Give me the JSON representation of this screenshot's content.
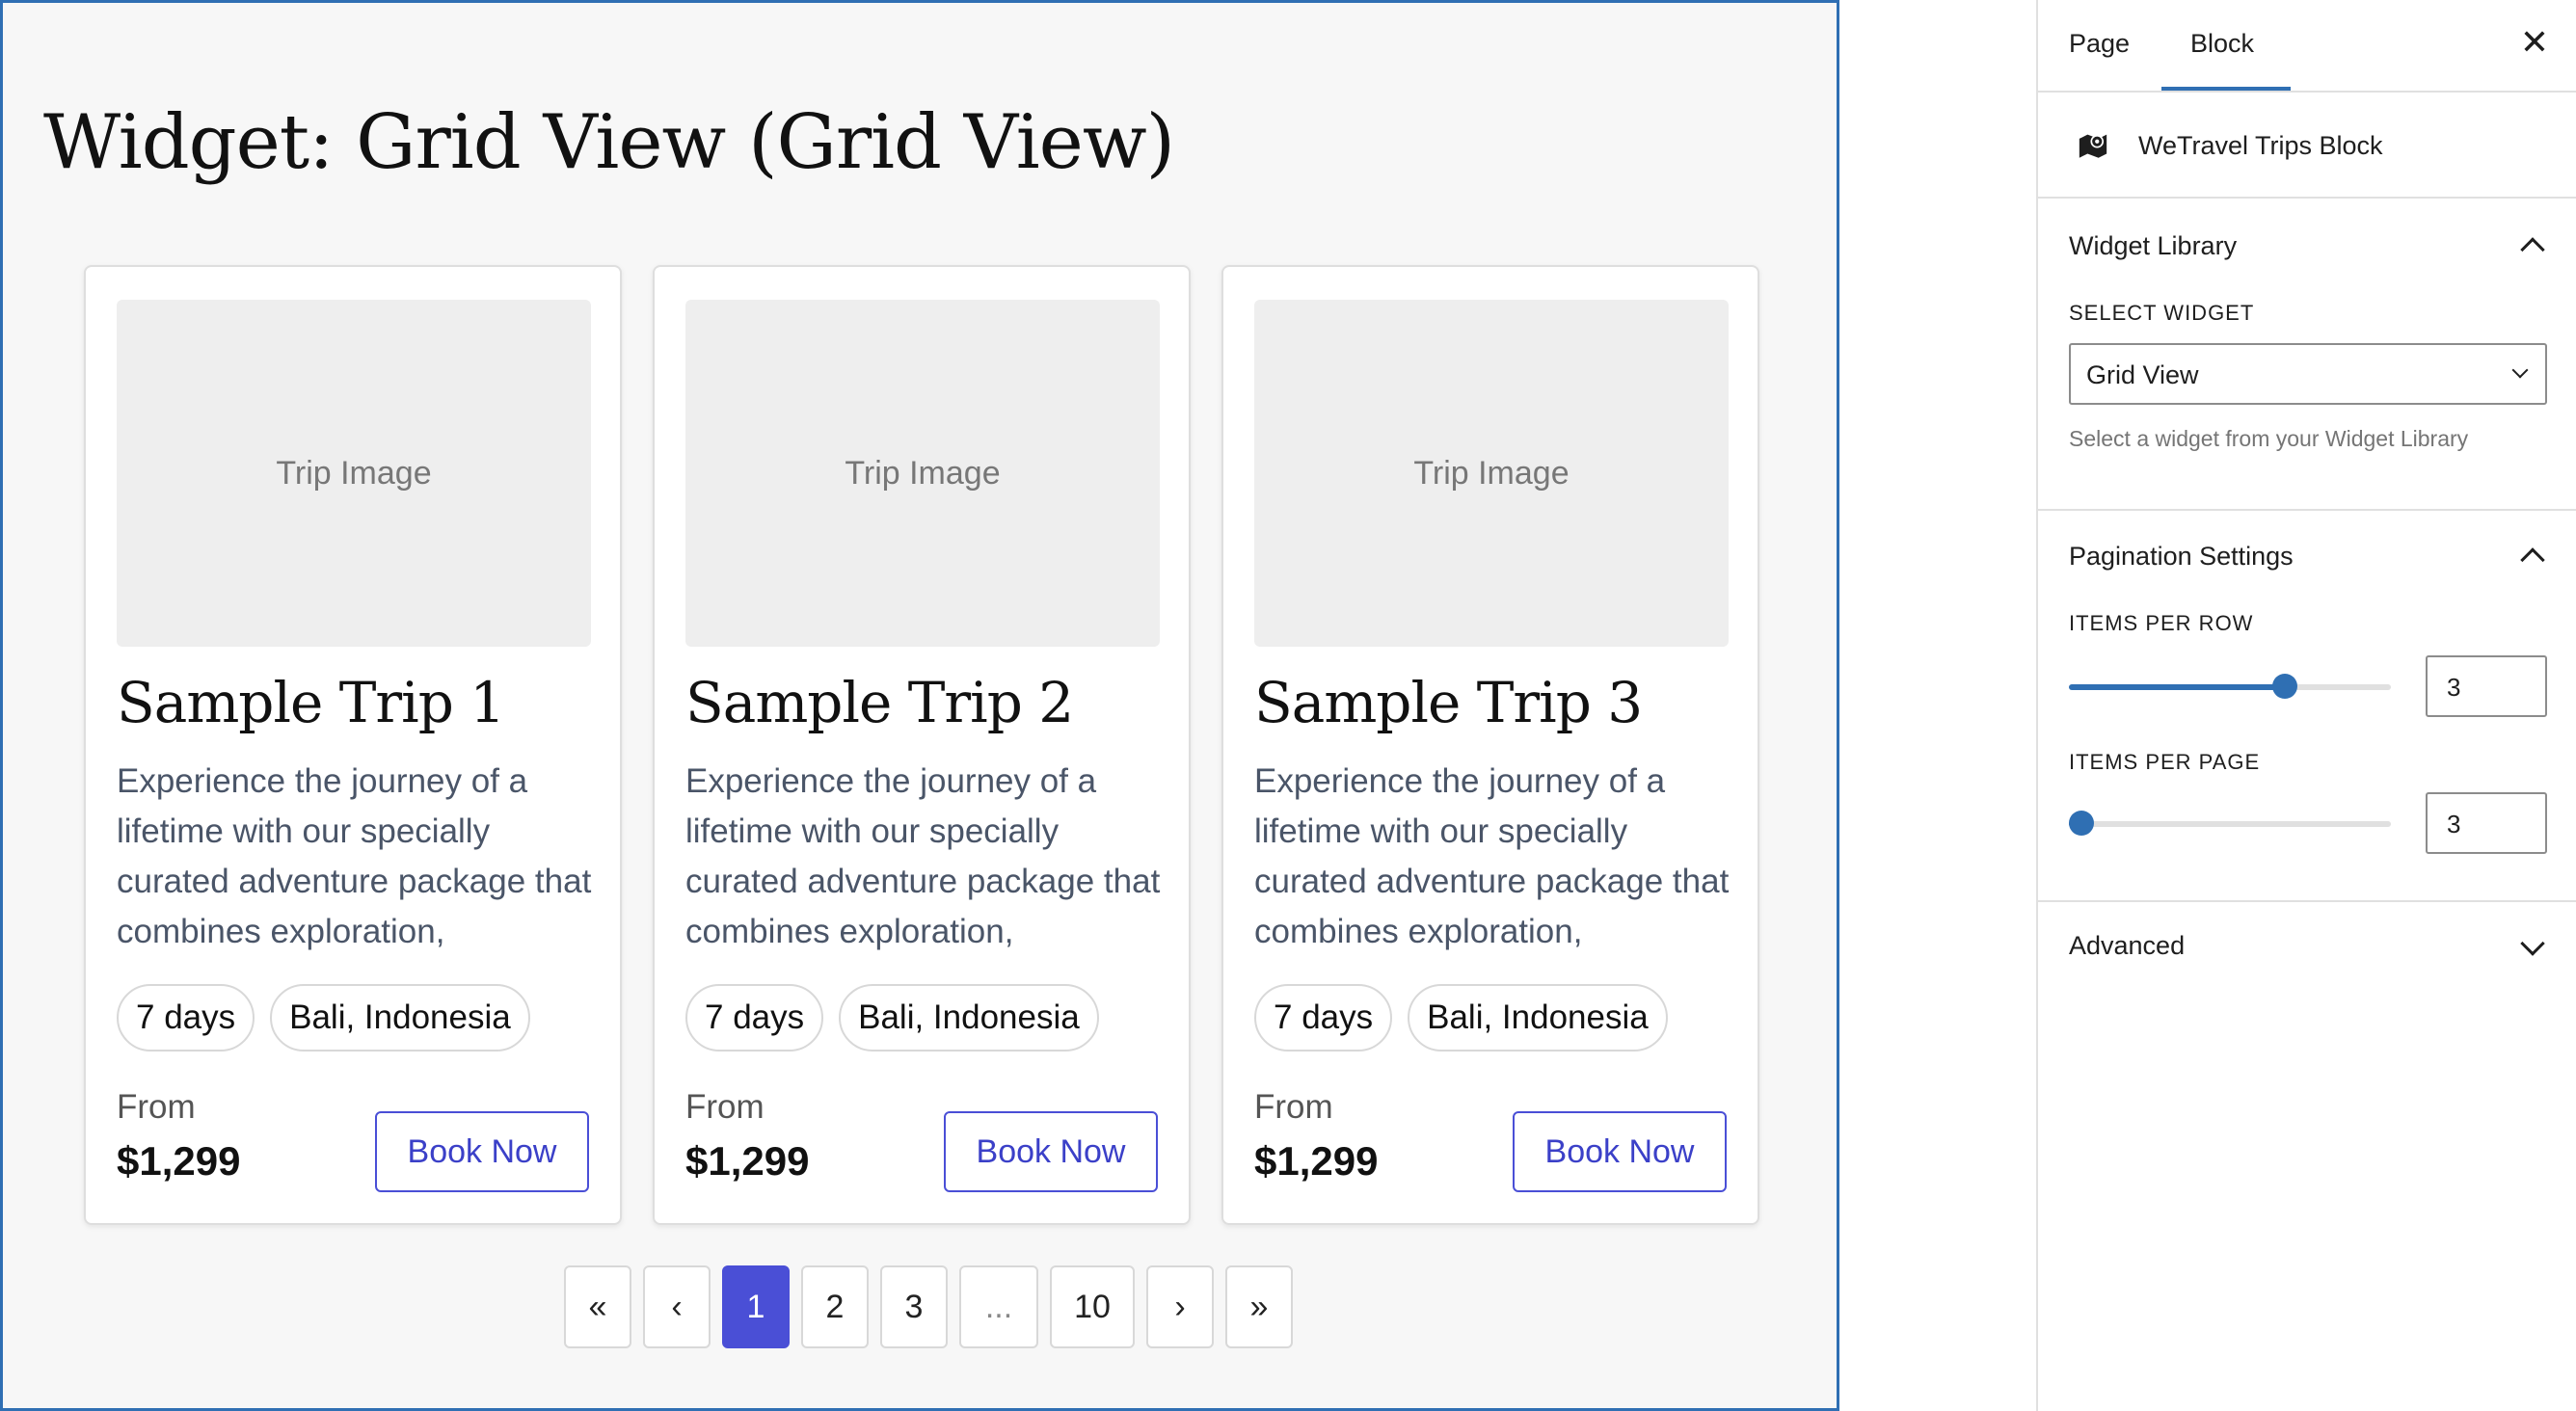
{
  "canvas": {
    "page_title": "Widget: Grid View (Grid View)",
    "cards": [
      {
        "image_label": "Trip Image",
        "title": "Sample Trip 1",
        "description": "Experience the journey of a lifetime with our specially curated adventure package that combines exploration,",
        "duration": "7 days",
        "location": "Bali, Indonesia",
        "from_label": "From",
        "price": "$1,299",
        "book_label": "Book Now"
      },
      {
        "image_label": "Trip Image",
        "title": "Sample Trip 2",
        "description": "Experience the journey of a lifetime with our specially curated adventure package that combines exploration,",
        "duration": "7 days",
        "location": "Bali, Indonesia",
        "from_label": "From",
        "price": "$1,299",
        "book_label": "Book Now"
      },
      {
        "image_label": "Trip Image",
        "title": "Sample Trip 3",
        "description": "Experience the journey of a lifetime with our specially curated adventure package that combines exploration,",
        "duration": "7 days",
        "location": "Bali, Indonesia",
        "from_label": "From",
        "price": "$1,299",
        "book_label": "Book Now"
      }
    ],
    "pagination": {
      "first": "«",
      "prev": "‹",
      "pages": [
        "1",
        "2",
        "3"
      ],
      "ellipsis": "...",
      "last_page": "10",
      "next": "›",
      "last": "»",
      "current": "1"
    }
  },
  "sidebar": {
    "tabs": {
      "page": "Page",
      "block": "Block",
      "active": "Block"
    },
    "close_icon": "close-icon",
    "block": {
      "icon": "map-marker-icon",
      "name": "WeTravel Trips Block"
    },
    "widget_library": {
      "title": "Widget Library",
      "expanded": true,
      "select_label": "SELECT WIDGET",
      "selected": "Grid View",
      "help": "Select a widget from your Widget Library"
    },
    "pagination_settings": {
      "title": "Pagination Settings",
      "expanded": true,
      "items_per_row_label": "ITEMS PER ROW",
      "items_per_row": "3",
      "items_per_row_fraction": 0.67,
      "items_per_page_label": "ITEMS PER PAGE",
      "items_per_page": "3",
      "items_per_page_fraction": 0.04
    },
    "advanced": {
      "title": "Advanced",
      "expanded": false
    }
  },
  "colors": {
    "accent": "#2f6fb3",
    "button": "#4a4fd6",
    "canvas_bg": "#f7f7f7"
  }
}
